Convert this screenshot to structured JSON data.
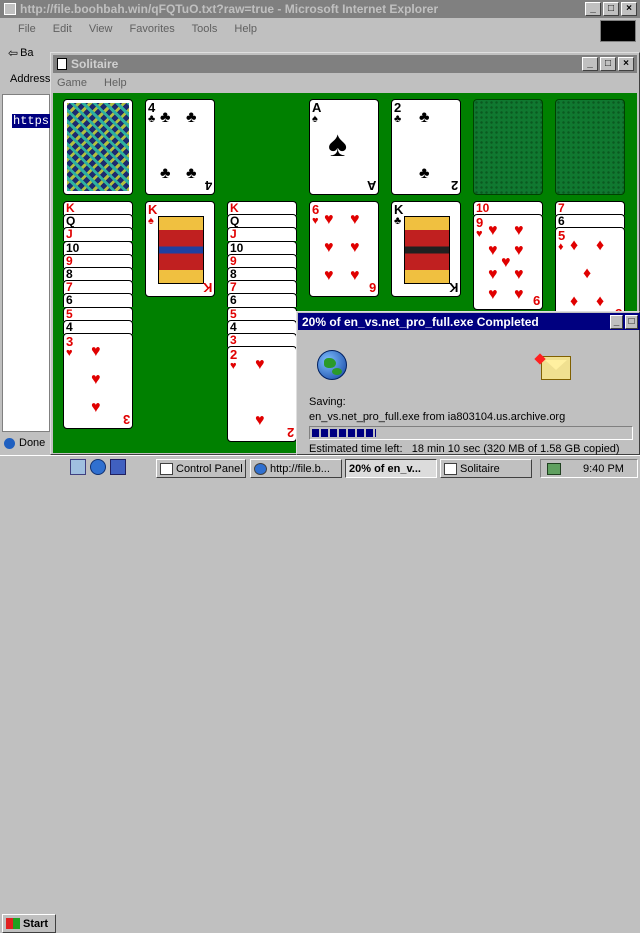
{
  "ie_window": {
    "title": "http://file.boohbah.win/qFQTuO.txt?raw=true - Microsoft Internet Explorer",
    "menu": [
      "File",
      "Edit",
      "View",
      "Favorites",
      "Tools",
      "Help"
    ],
    "back_label": "Ba",
    "address_label": "Address",
    "content_text": "https",
    "status_text": "Done"
  },
  "solitaire": {
    "title": "Solitaire",
    "menu": [
      "Game",
      "Help"
    ],
    "felt_color": "#008000",
    "stock": {
      "pattern": "woven-back"
    },
    "waste": {
      "rank": "4",
      "suit": "clubs",
      "suit_glyph": "♣"
    },
    "foundations": [
      {
        "rank": "A",
        "suit": "spades",
        "suit_glyph": "♠"
      },
      {
        "rank": "2",
        "suit": "clubs",
        "suit_glyph": "♣"
      },
      {
        "empty": true
      },
      {
        "empty": true
      }
    ],
    "tableau": [
      {
        "strips": [
          "K",
          "Q",
          "J",
          "10",
          "9",
          "8",
          "7",
          "6",
          "5",
          "4"
        ],
        "top": {
          "rank": "3",
          "suit_glyph": "♥",
          "color": "red"
        }
      },
      {
        "strips": [],
        "top": {
          "rank": "K",
          "face": "Q",
          "suit_glyph": "♠",
          "color": "red"
        }
      },
      {
        "strips": [
          "K",
          "Q",
          "J",
          "10",
          "9",
          "8",
          "7",
          "6",
          "5",
          "4",
          "3"
        ],
        "top": {
          "rank": "2",
          "suit_glyph": "♥",
          "color": "red"
        }
      },
      {
        "strips": [],
        "top": {
          "rank": "6",
          "suit_glyph": "♥",
          "color": "red"
        }
      },
      {
        "strips": [],
        "top": {
          "rank": "K",
          "suit_glyph": "♣",
          "color": "blk"
        }
      },
      {
        "strips": [
          "10"
        ],
        "top": {
          "rank": "9",
          "suit_glyph": "♥",
          "color": "red"
        }
      },
      {
        "strips": [
          "7",
          "6"
        ],
        "top": {
          "rank": "5",
          "suit_glyph": "♦",
          "color": "red"
        }
      }
    ]
  },
  "download": {
    "title": "20% of en_vs.net_pro_full.exe Completed",
    "saving_label": "Saving:",
    "saving_text": "en_vs.net_pro_full.exe from ia803104.us.archive.org",
    "progress_percent": 20,
    "eta_text": "Estimated time left:   18 min 10 sec (320 MB of 1.58 GB copied)"
  },
  "taskbar": {
    "start_label": "Start",
    "buttons": [
      "Control Panel",
      "http://file.b...",
      "20% of en_v...",
      "Solitaire"
    ],
    "clock": "9:40 PM"
  },
  "icons": {
    "globe": "globe-icon",
    "folder": "folder-icon",
    "ie": "ie-icon"
  }
}
